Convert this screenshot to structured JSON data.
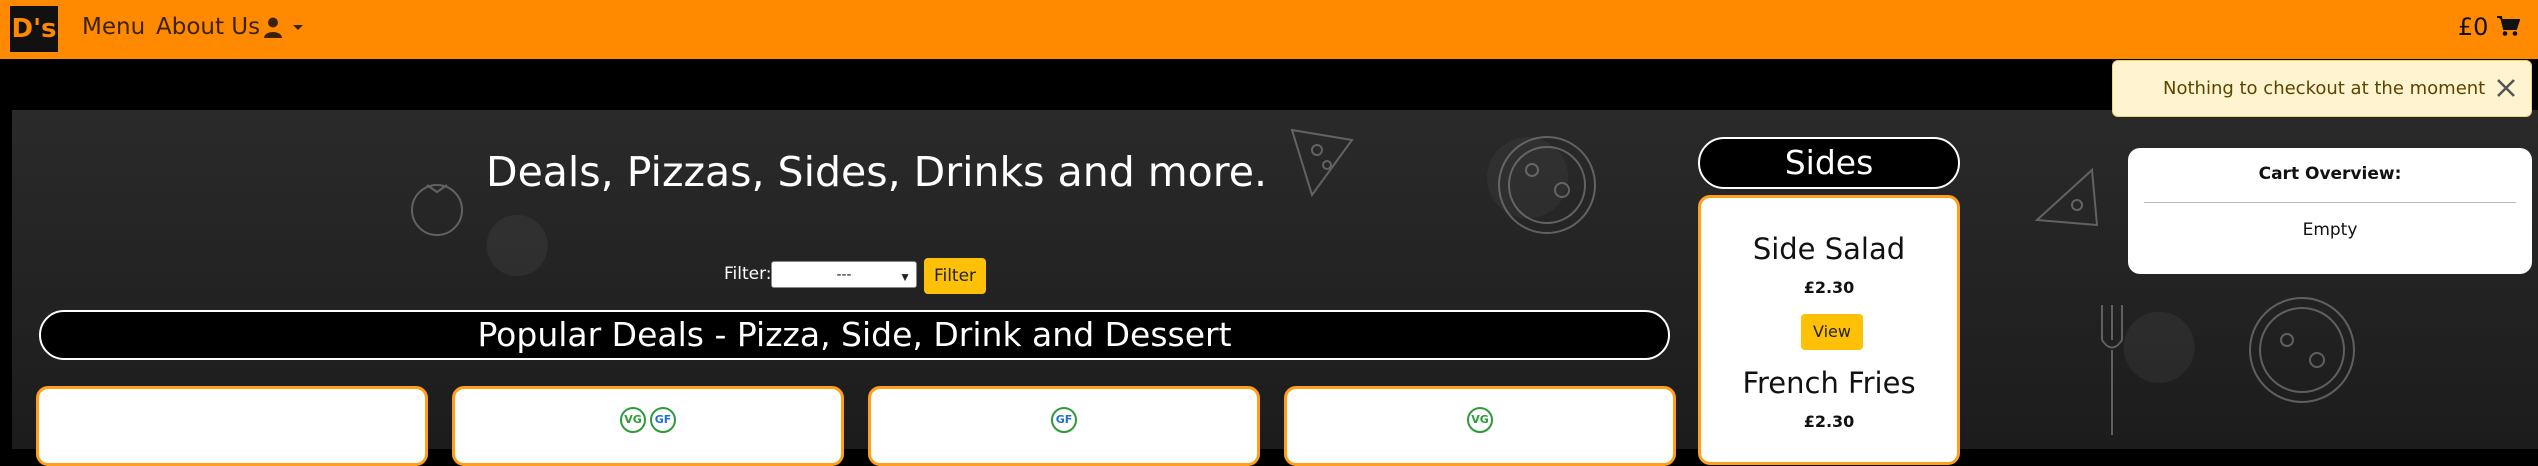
{
  "navbar": {
    "logo_text": "D's",
    "links": [
      {
        "label": "Menu"
      },
      {
        "label": "About Us"
      }
    ],
    "user_icon": "user-icon",
    "caret_icon": "caret-down-icon",
    "cart_total": "£0",
    "cart_icon": "shopping-cart-icon",
    "bg_color": "#ff8a00"
  },
  "toast": {
    "message": "Nothing to checkout at the moment",
    "close_icon": "close-icon"
  },
  "hero": {
    "title": "Deals, Pizzas, Sides, Drinks and more."
  },
  "filter": {
    "label": "Filter:",
    "selected": "---",
    "button_label": "Filter"
  },
  "deals_section": {
    "title": "Popular Deals - Pizza, Side, Drink and Dessert",
    "cards": [
      {
        "badges": []
      },
      {
        "badges": [
          "VG",
          "GF"
        ]
      },
      {
        "badges": [
          "GF"
        ]
      },
      {
        "badges": [
          "VG"
        ]
      }
    ]
  },
  "sides": {
    "title": "Sides",
    "items": [
      {
        "name": "Side Salad",
        "price": "£2.30",
        "button_label": "View"
      },
      {
        "name": "French Fries",
        "price": "£2.30"
      }
    ]
  },
  "cart_overview": {
    "title": "Cart Overview:",
    "status": "Empty"
  },
  "colors": {
    "accent_orange": "#ff8a00",
    "button_yellow": "#ffc107",
    "card_border": "#ff9f1c",
    "vegan_green": "#2e9b3a",
    "gluten_free_blue": "#1e6fd9"
  }
}
